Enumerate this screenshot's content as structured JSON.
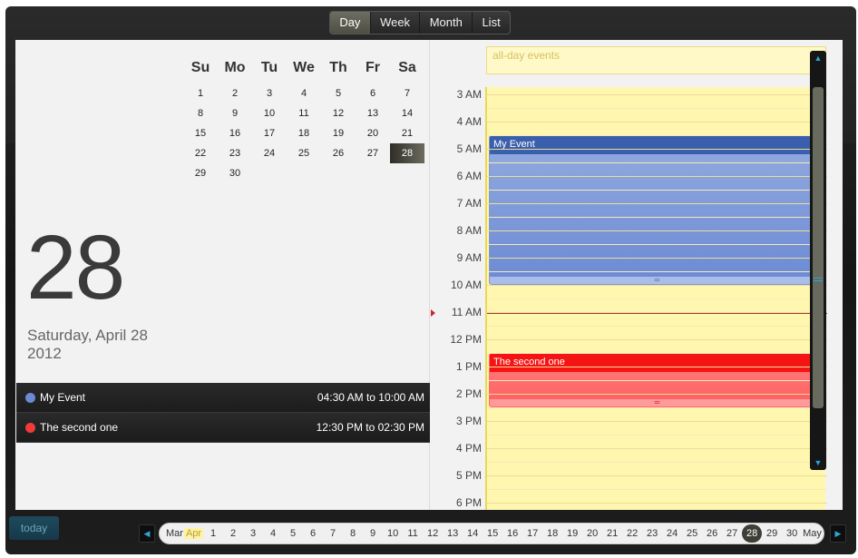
{
  "views": [
    "Day",
    "Week",
    "Month",
    "List"
  ],
  "active_view": "Day",
  "mini_calendar": {
    "weekdays": [
      "Su",
      "Mo",
      "Tu",
      "We",
      "Th",
      "Fr",
      "Sa"
    ],
    "weeks": [
      [
        "1",
        "2",
        "3",
        "4",
        "5",
        "6",
        "7"
      ],
      [
        "8",
        "9",
        "10",
        "11",
        "12",
        "13",
        "14"
      ],
      [
        "15",
        "16",
        "17",
        "18",
        "19",
        "20",
        "21"
      ],
      [
        "22",
        "23",
        "24",
        "25",
        "26",
        "27",
        "28"
      ],
      [
        "29",
        "30",
        "",
        "",
        "",
        "",
        ""
      ]
    ],
    "selected": "28"
  },
  "selected_date": {
    "day": "28",
    "weekday_month": "Saturday, April 28",
    "year": "2012"
  },
  "events": [
    {
      "title": "My Event",
      "time": "04:30 AM to 10:00 AM",
      "color": "#6b8ad4"
    },
    {
      "title": "The second one",
      "time": "12:30 PM to 02:30 PM",
      "color": "#f23a3a"
    }
  ],
  "allday_label": "all-day events",
  "hours": [
    "3 AM",
    "4 AM",
    "5 AM",
    "6 AM",
    "7 AM",
    "8 AM",
    "9 AM",
    "10 AM",
    "11 AM",
    "12 PM",
    "1 PM",
    "2 PM",
    "3 PM",
    "4 PM",
    "5 PM",
    "6 PM"
  ],
  "today_label": "today",
  "datebar": {
    "prev_month": "Mar",
    "current_month": "Apr",
    "days": [
      "1",
      "2",
      "3",
      "4",
      "5",
      "6",
      "7",
      "8",
      "9",
      "10",
      "11",
      "12",
      "13",
      "14",
      "15",
      "16",
      "17",
      "18",
      "19",
      "20",
      "21",
      "22",
      "23",
      "24",
      "25",
      "26",
      "27",
      "28",
      "29",
      "30"
    ],
    "selected": "28",
    "next_month": "May"
  }
}
